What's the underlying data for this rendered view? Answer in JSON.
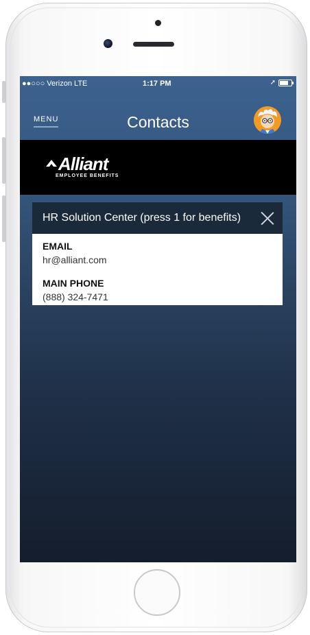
{
  "status_bar": {
    "carrier": "●●○○○ Verizon  LTE",
    "time": "1:17 PM",
    "location_glyph": "➚"
  },
  "nav": {
    "menu_label": "MENU",
    "title": "Contacts",
    "avatar_icon": "professor-avatar-icon"
  },
  "brand": {
    "name": "Alliant",
    "tagline": "EMPLOYEE BENEFITS"
  },
  "contact_card": {
    "title": "HR Solution Center (press 1 for benefits)",
    "fields": [
      {
        "label": "EMAIL",
        "value": "hr@alliant.com"
      },
      {
        "label": "MAIN PHONE",
        "value": "(888) 324-7471"
      }
    ]
  },
  "colors": {
    "screen_top": "#3d628f",
    "screen_bottom": "#141d2c",
    "card_header": "#1b2a3b",
    "avatar_bg": "#f29a22"
  }
}
